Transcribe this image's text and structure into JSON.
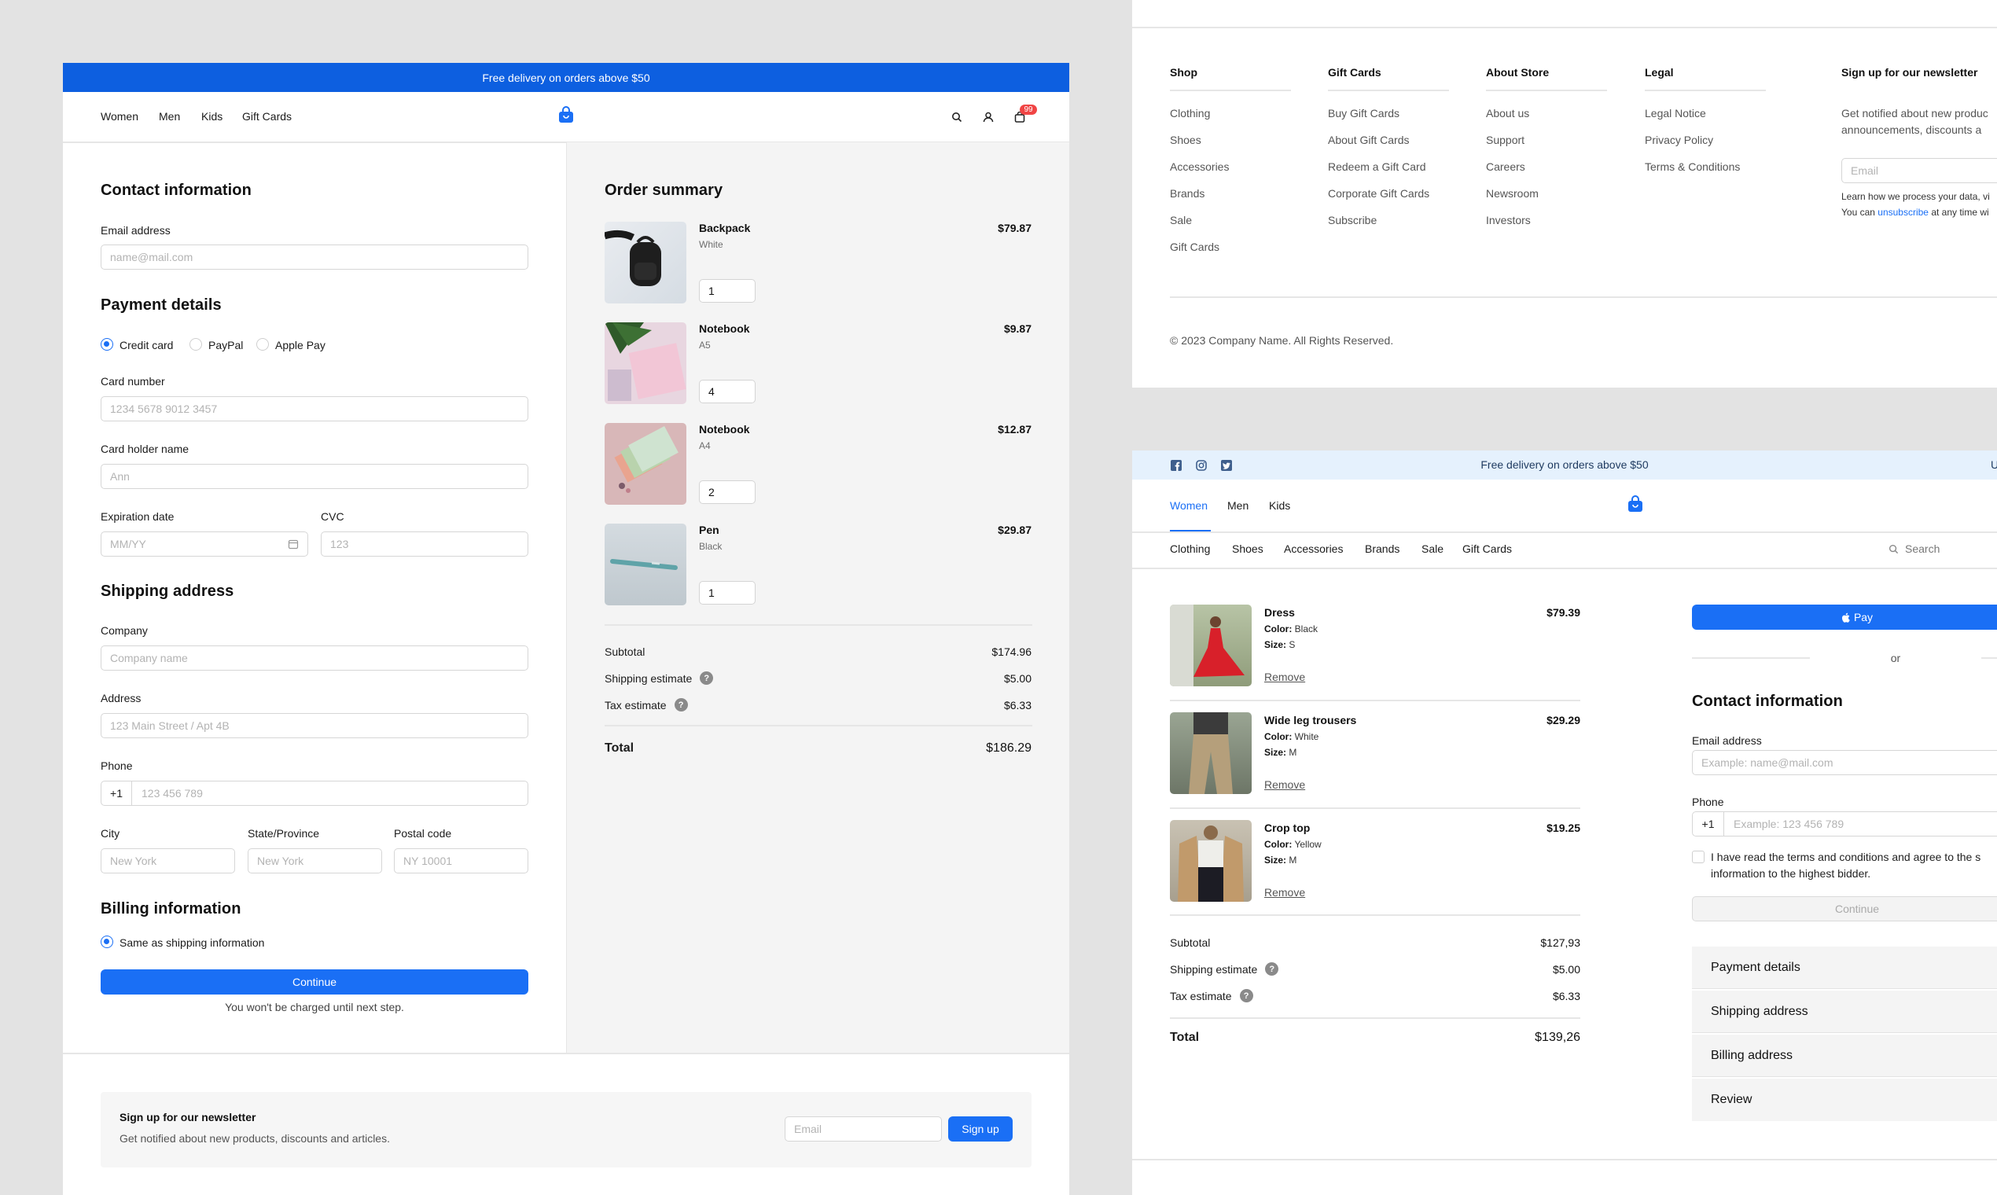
{
  "panel1": {
    "banner": "Free delivery on orders above $50",
    "nav": [
      "Women",
      "Men",
      "Kids",
      "Gift Cards"
    ],
    "cart_count": "99",
    "contact": {
      "title": "Contact information",
      "email_label": "Email address",
      "email_placeholder": "name@mail.com"
    },
    "payment": {
      "title": "Payment details",
      "methods": [
        "Credit card",
        "PayPal",
        "Apple Pay"
      ],
      "selected": "Credit card",
      "card_number_label": "Card number",
      "card_number_placeholder": "1234 5678 9012 3457",
      "holder_label": "Card holder name",
      "holder_placeholder": "Ann",
      "exp_label": "Expiration date",
      "exp_placeholder": "MM/YY",
      "cvc_label": "CVC",
      "cvc_placeholder": "123"
    },
    "shipping": {
      "title": "Shipping address",
      "company_label": "Company",
      "company_placeholder": "Company name",
      "address_label": "Address",
      "address_placeholder": "123 Main Street / Apt 4B",
      "phone_label": "Phone",
      "phone_prefix": "+1",
      "phone_placeholder": "123 456 789",
      "city_label": "City",
      "city_placeholder": "New York",
      "state_label": "State/Province",
      "state_placeholder": "New York",
      "postal_label": "Postal code",
      "postal_placeholder": "NY 10001"
    },
    "billing": {
      "title": "Billing information",
      "same_label": "Same as shipping information"
    },
    "continue_label": "Continue",
    "charge_note": "You won't be charged until next step.",
    "summary": {
      "title": "Order summary",
      "items": [
        {
          "name": "Backpack",
          "variant": "White",
          "price": "$79.87",
          "qty": "1"
        },
        {
          "name": "Notebook",
          "variant": "A5",
          "price": "$9.87",
          "qty": "4"
        },
        {
          "name": "Notebook",
          "variant": "A4",
          "price": "$12.87",
          "qty": "2"
        },
        {
          "name": "Pen",
          "variant": "Black",
          "price": "$29.87",
          "qty": "1"
        }
      ],
      "subtotal_label": "Subtotal",
      "subtotal": "$174.96",
      "shipping_label": "Shipping estimate",
      "shipping": "$5.00",
      "tax_label": "Tax estimate",
      "tax": "$6.33",
      "total_label": "Total",
      "total": "$186.29"
    },
    "newsletter": {
      "title": "Sign up for our newsletter",
      "text": "Get notified about new products, discounts and articles.",
      "email_placeholder": "Email",
      "button": "Sign up"
    }
  },
  "panel2": {
    "columns": [
      {
        "title": "Shop",
        "links": [
          "Clothing",
          "Shoes",
          "Accessories",
          "Brands",
          "Sale",
          "Gift Cards"
        ]
      },
      {
        "title": "Gift Cards",
        "links": [
          "Buy Gift Cards",
          "About Gift Cards",
          "Redeem a Gift Card",
          "Corporate Gift Cards",
          "Subscribe"
        ]
      },
      {
        "title": "About Store",
        "links": [
          "About us",
          "Support",
          "Careers",
          "Newsroom",
          "Investors"
        ]
      },
      {
        "title": "Legal",
        "links": [
          "Legal Notice",
          "Privacy Policy",
          "Terms & Conditions"
        ]
      }
    ],
    "newsletter_title": "Sign up for our newsletter",
    "newsletter_text_1": "Get notified about new produc",
    "newsletter_text_2": "announcements, discounts a",
    "email_placeholder": "Email",
    "privacy_1": "Learn how we process your data, vi",
    "privacy_2_a": "You can ",
    "privacy_2_link": "unsubscribe",
    "privacy_2_b": " at any time wi",
    "copyright": "© 2023 Company Name. All Rights Reserved."
  },
  "panel3": {
    "banner": "Free delivery on orders above $50",
    "banner_right": "U",
    "nav": [
      "Women",
      "Men",
      "Kids"
    ],
    "subnav": [
      "Clothing",
      "Shoes",
      "Accessories",
      "Brands",
      "Sale",
      "Gift Cards"
    ],
    "search_placeholder": "Search",
    "cart": [
      {
        "name": "Dress",
        "color": "Black",
        "size": "S",
        "price": "$79.39"
      },
      {
        "name": "Wide leg trousers",
        "color": "White",
        "size": "M",
        "price": "$29.29"
      },
      {
        "name": "Crop top",
        "color": "Yellow",
        "size": "M",
        "price": "$19.25"
      }
    ],
    "color_label": "Color:",
    "size_label": "Size:",
    "remove_label": "Remove",
    "subtotal_label": "Subtotal",
    "subtotal": "$127,93",
    "shipping_label": "Shipping estimate",
    "shipping": "$5.00",
    "tax_label": "Tax estimate",
    "tax": "$6.33",
    "total_label": "Total",
    "total": "$139,26",
    "apple_pay": "Pay",
    "or": "or",
    "contact_title": "Contact information",
    "email_label": "Email address",
    "email_placeholder": "Example: name@mail.com",
    "phone_label": "Phone",
    "phone_prefix": "+1",
    "phone_placeholder": "Example: 123 456 789",
    "terms_1": "I have read the terms and conditions and agree to the s",
    "terms_2": "information to the highest bidder.",
    "continue_label": "Continue",
    "steps": [
      "Payment details",
      "Shipping address",
      "Billing address",
      "Review"
    ]
  },
  "colors": {
    "accent": "#1a6ff5",
    "badge": "#f04444",
    "panel_bg": "#f4f4f4"
  }
}
